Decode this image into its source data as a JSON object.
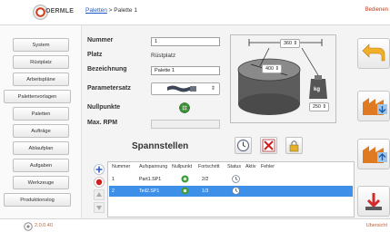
{
  "header": {
    "logo_text": "OERMLE",
    "breadcrumb_link": "Paletten",
    "breadcrumb_sep": " > ",
    "breadcrumb_current": "Palette 1",
    "top_link": "Bedienen"
  },
  "sidebar": {
    "items": [
      {
        "label": "System"
      },
      {
        "label": "Rüstplatz"
      },
      {
        "label": "Arbeitspläne"
      },
      {
        "label": "Palettenvorlagen"
      },
      {
        "label": "Paletten"
      },
      {
        "label": "Aufträge"
      },
      {
        "label": "Ablaufplan"
      },
      {
        "label": "Aufgaben"
      },
      {
        "label": "Werkzeuge"
      },
      {
        "label": "Produktionslog"
      }
    ]
  },
  "form": {
    "nummer_label": "Nummer",
    "nummer_value": "1",
    "platz_label": "Platz",
    "platz_value": "Rüstplatz",
    "bezeichnung_label": "Bezeichnung",
    "bezeichnung_value": "Palette 1",
    "parametersatz_label": "Parametersatz",
    "parametersatz_arrow": "⇕",
    "nullpunkte_label": "Nullpunkte",
    "maxrpm_label": "Max. RPM",
    "maxrpm_value": ""
  },
  "tool": {
    "width_value": "360",
    "diameter_value": "400",
    "weight_value": "250",
    "weight_unit": "kg",
    "spin_suffix": "⇕"
  },
  "spannstellen": {
    "title": "Spannstellen",
    "columns": [
      "Nummer",
      "Aufspannung",
      "Nullpunkt",
      "Fortschritt",
      "Status",
      "Aktiv",
      "Fehler"
    ],
    "rows": [
      {
        "nummer": "1",
        "aufspannung": "Part1.SP1",
        "fortschritt": "2/2"
      },
      {
        "nummer": "2",
        "aufspannung": "Teil2.SP1",
        "fortschritt": "1/3"
      }
    ]
  },
  "footer": {
    "left_text": "2.0.0.40",
    "right_text": "Ubersicht"
  }
}
